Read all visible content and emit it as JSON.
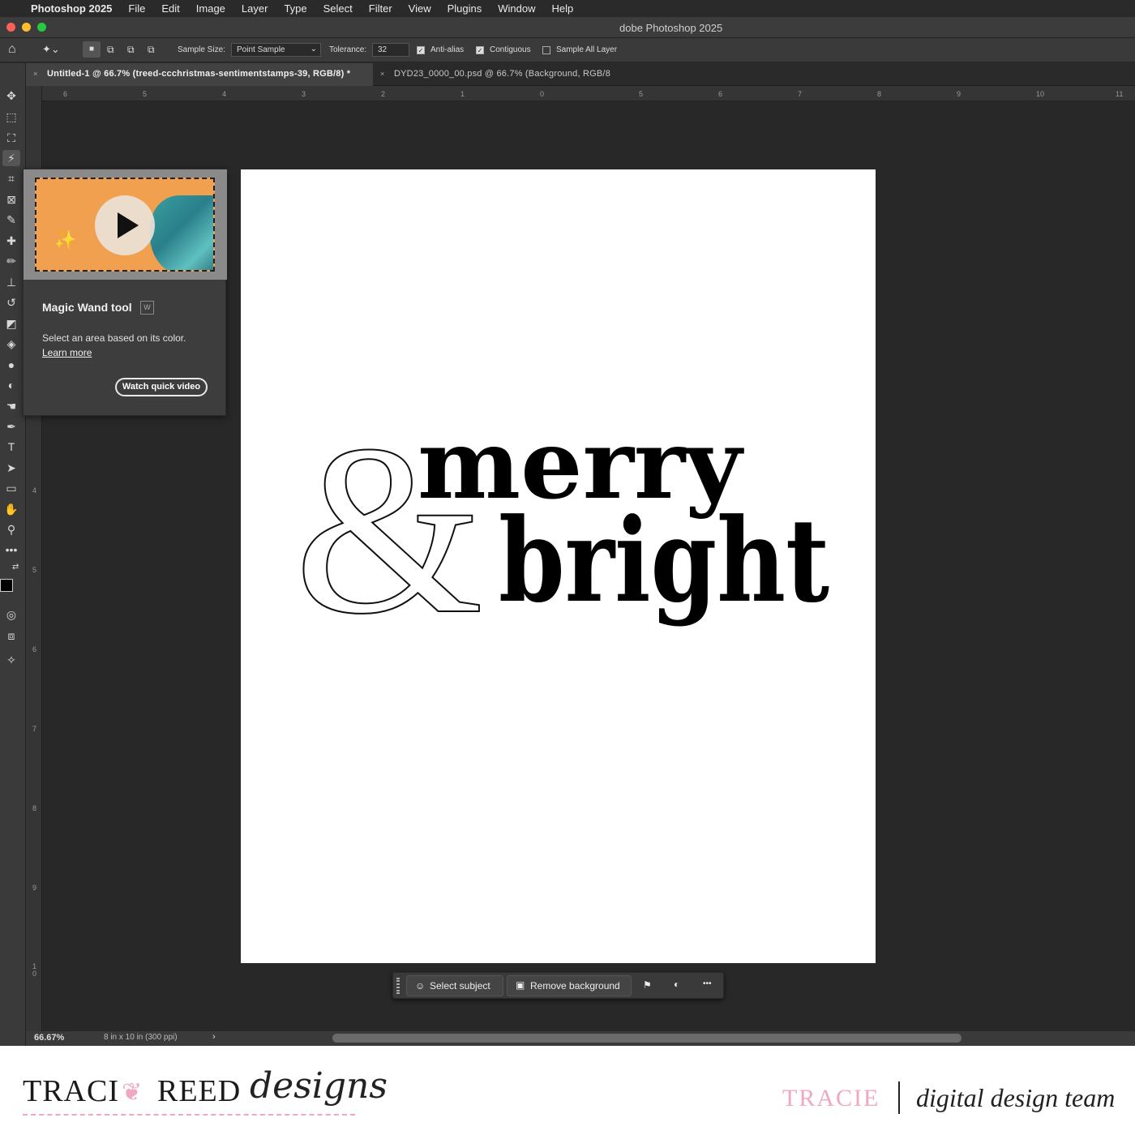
{
  "menubar": {
    "app_name": "Photoshop 2025",
    "items": [
      "File",
      "Edit",
      "Image",
      "Layer",
      "Type",
      "Select",
      "Filter",
      "View",
      "Plugins",
      "Window",
      "Help"
    ]
  },
  "window": {
    "title": "dobe Photoshop 2025"
  },
  "options": {
    "sample_size_label": "Sample Size:",
    "sample_size_value": "Point Sample",
    "tolerance_label": "Tolerance:",
    "tolerance_value": "32",
    "anti_alias": "Anti-alias",
    "contiguous": "Contiguous",
    "sample_all": "Sample All Layer"
  },
  "tabs": [
    {
      "label": "Untitled-1 @ 66.7% (treed-ccchristmas-sentimentstamps-39, RGB/8) *",
      "active": true
    },
    {
      "label": "DYD23_0000_00.psd @ 66.7% (Background, RGB/8",
      "active": false
    }
  ],
  "rulers": {
    "h_ticks": [
      "6",
      "5",
      "4",
      "3",
      "2",
      "1",
      "0",
      "5",
      "6",
      "7",
      "8",
      "9",
      "10",
      "11"
    ],
    "v_ticks": [
      "4",
      "5",
      "6",
      "7",
      "8",
      "9",
      "1\n0"
    ]
  },
  "tooltip": {
    "title": "Magic Wand tool",
    "shortcut": "W",
    "description": "Select an area based on its color.",
    "learn_more": "Learn more",
    "video_button": "Watch quick video"
  },
  "document": {
    "word1": "merry",
    "ampersand": "&",
    "word2": "bright"
  },
  "context_bar": {
    "select_subject": "Select subject",
    "remove_background": "Remove background",
    "more": "•••"
  },
  "status": {
    "zoom": "66.67%",
    "doc_size": "8 in x 10 in (300 ppi)",
    "arrow": "›"
  },
  "footer": {
    "brand_part1": "TRACI",
    "brand_part2": "REED",
    "brand_script": "designs",
    "name": "TRACIE",
    "team": "digital design team"
  },
  "colors": {
    "traffic_red": "#fe5f57",
    "traffic_yellow": "#febc2e",
    "traffic_green": "#28c840",
    "thumb_orange": "#f0a04f",
    "pink": "#f0a8c0"
  }
}
